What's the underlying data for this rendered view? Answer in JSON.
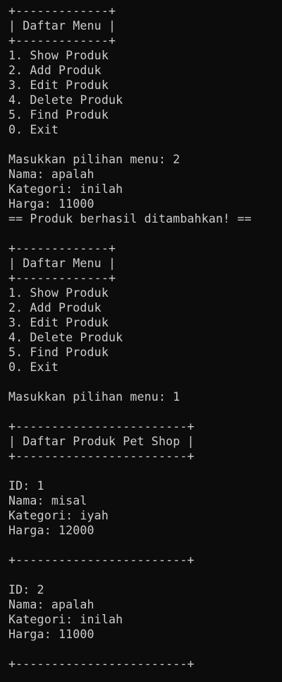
{
  "terminal": {
    "background": "#0c0c0c",
    "foreground": "#cccccc",
    "lines": [
      "+-------------+",
      "| Daftar Menu |",
      "+-------------+",
      "1. Show Produk",
      "2. Add Produk",
      "3. Edit Produk",
      "4. Delete Produk",
      "5. Find Produk",
      "0. Exit",
      "",
      "Masukkan pilihan menu: 2",
      "Nama: apalah",
      "Kategori: inilah",
      "Harga: 11000",
      "== Produk berhasil ditambahkan! ==",
      "",
      "+-------------+",
      "| Daftar Menu |",
      "+-------------+",
      "1. Show Produk",
      "2. Add Produk",
      "3. Edit Produk",
      "4. Delete Produk",
      "5. Find Produk",
      "0. Exit",
      "",
      "Masukkan pilihan menu: 1",
      "",
      "+------------------------+",
      "| Daftar Produk Pet Shop |",
      "+------------------------+",
      "",
      "ID: 1",
      "Nama: misal",
      "Kategori: iyah",
      "Harga: 12000",
      "",
      "+------------------------+",
      "",
      "ID: 2",
      "Nama: apalah",
      "Kategori: inilah",
      "Harga: 11000",
      "",
      "+------------------------+"
    ]
  }
}
